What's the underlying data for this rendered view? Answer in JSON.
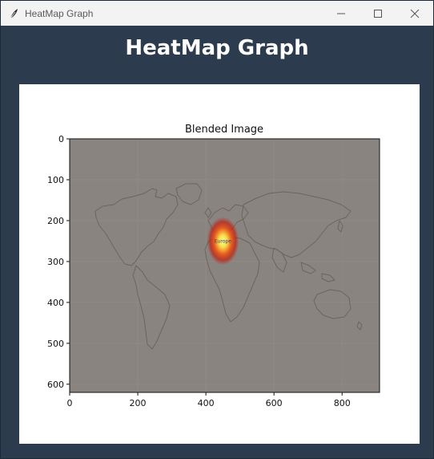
{
  "window": {
    "title": "HeatMap Graph",
    "icons": {
      "app": "feather-icon",
      "minimize": "minimize-icon",
      "maximize": "maximize-icon",
      "close": "close-icon"
    }
  },
  "header": {
    "title": "HeatMap Graph"
  },
  "chart_data": {
    "type": "heatmap",
    "title": "Blended Image",
    "xlabel": "",
    "ylabel": "",
    "xlim": [
      0,
      910
    ],
    "ylim": [
      620,
      0
    ],
    "x_ticks": [
      0,
      200,
      400,
      600,
      800
    ],
    "y_ticks": [
      0,
      100,
      200,
      300,
      400,
      500,
      600
    ],
    "background": "world map (grey)",
    "hotspot": {
      "x": 450,
      "y": 250,
      "label": "Europe"
    },
    "colors": {
      "map_background": "#8a8480",
      "outline": "#6f6a66",
      "hot_core": "#f7e04a",
      "hot_mid": "#ee5a1a",
      "hot_edge": "#c02010"
    }
  }
}
